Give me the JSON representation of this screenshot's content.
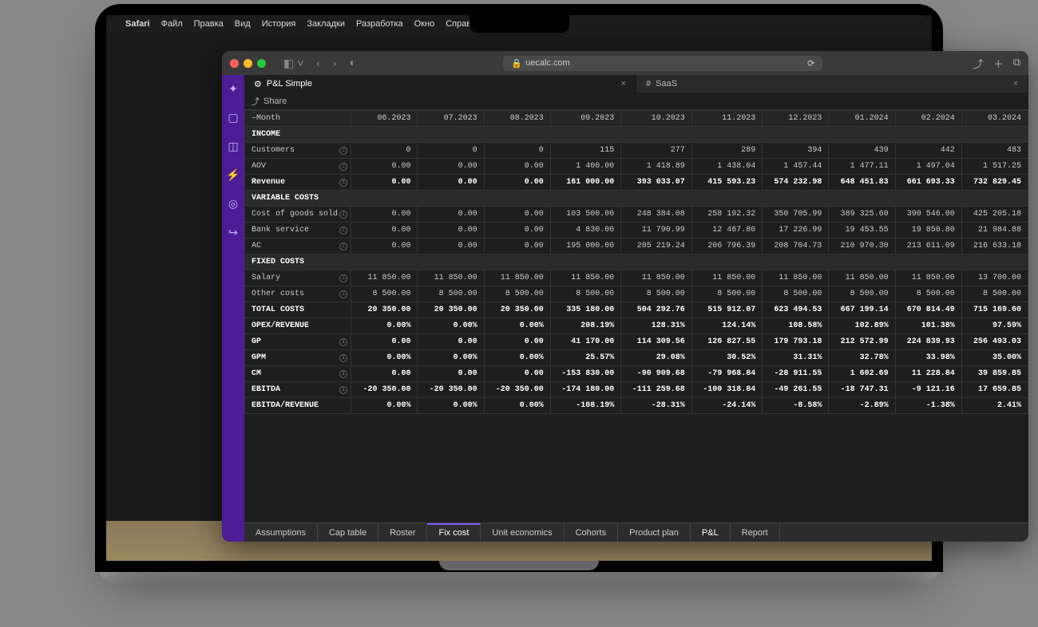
{
  "menubar": {
    "apple": "",
    "app_name": "Safari",
    "items": [
      "Файл",
      "Правка",
      "Вид",
      "История",
      "Закладки",
      "Разработка",
      "Окно",
      "Справка"
    ]
  },
  "browser": {
    "url": "uecalc.com",
    "lock": "🔒"
  },
  "tabs": [
    {
      "icon": "⚙",
      "label": "P&L Simple",
      "active": true
    },
    {
      "icon": "#",
      "label": "SaaS",
      "active": false
    }
  ],
  "share_label": "Share",
  "table": {
    "header_first": "Month",
    "months": [
      "06.2023",
      "07.2023",
      "08.2023",
      "09.2023",
      "10.2023",
      "11.2023",
      "12.2023",
      "01.2024",
      "02.2024",
      "03.2024"
    ],
    "rows": [
      {
        "type": "section",
        "label": "INCOME"
      },
      {
        "label": "Customers",
        "info": true,
        "values": [
          "0",
          "0",
          "0",
          "115",
          "277",
          "289",
          "394",
          "439",
          "442",
          "483"
        ]
      },
      {
        "label": "AOV",
        "info": true,
        "values": [
          "0.00",
          "0.00",
          "0.00",
          "1 400.00",
          "1 418.89",
          "1 438.04",
          "1 457.44",
          "1 477.11",
          "1 497.04",
          "1 517.25"
        ]
      },
      {
        "label": "Revenue",
        "info": true,
        "bold": true,
        "values": [
          "0.00",
          "0.00",
          "0.00",
          "161 000.00",
          "393 033.07",
          "415 593.23",
          "574 232.98",
          "648 451.83",
          "661 693.33",
          "732 829.45"
        ]
      },
      {
        "type": "section",
        "label": "VARIABLE COSTS"
      },
      {
        "label": "Cost of goods sold",
        "info": true,
        "values": [
          "0.00",
          "0.00",
          "0.00",
          "103 500.00",
          "248 384.08",
          "258 192.32",
          "350 705.99",
          "389 325.60",
          "390 546.00",
          "425 205.18"
        ]
      },
      {
        "label": "Bank service",
        "info": true,
        "values": [
          "0.00",
          "0.00",
          "0.00",
          "4 830.00",
          "11 790.99",
          "12 467.80",
          "17 226.99",
          "19 453.55",
          "19 850.80",
          "21 984.88"
        ]
      },
      {
        "label": "AC",
        "info": true,
        "values": [
          "0.00",
          "0.00",
          "0.00",
          "195 000.00",
          "205 219.24",
          "206 796.39",
          "208 704.73",
          "210 970.30",
          "213 611.09",
          "216 633.18"
        ]
      },
      {
        "type": "section",
        "label": "FIXED COSTS"
      },
      {
        "label": "Salary",
        "info": true,
        "values": [
          "11 850.00",
          "11 850.00",
          "11 850.00",
          "11 850.00",
          "11 850.00",
          "11 850.00",
          "11 850.00",
          "11 850.00",
          "11 850.00",
          "13 700.00"
        ]
      },
      {
        "label": "Other costs",
        "info": true,
        "values": [
          "8 500.00",
          "8 500.00",
          "8 500.00",
          "8 500.00",
          "8 500.00",
          "8 500.00",
          "8 500.00",
          "8 500.00",
          "8 500.00",
          "8 500.00"
        ]
      },
      {
        "label": "TOTAL COSTS",
        "bold": true,
        "values": [
          "20 350.00",
          "20 350.00",
          "20 350.00",
          "335 180.00",
          "504 292.76",
          "515 912.07",
          "623 494.53",
          "667 199.14",
          "670 814.49",
          "715 169.60"
        ]
      },
      {
        "label": "OPEX/REVENUE",
        "bold": true,
        "values": [
          "0.00%",
          "0.00%",
          "0.00%",
          "208.19%",
          "128.31%",
          "124.14%",
          "108.58%",
          "102.89%",
          "101.38%",
          "97.59%"
        ]
      },
      {
        "label": "GP",
        "info": true,
        "bold": true,
        "values": [
          "0.00",
          "0.00",
          "0.00",
          "41 170.00",
          "114 309.56",
          "126 827.55",
          "179 793.18",
          "212 572.99",
          "224 839.93",
          "256 493.03"
        ]
      },
      {
        "label": "GPM",
        "info": true,
        "bold": true,
        "values": [
          "0.00%",
          "0.00%",
          "0.00%",
          "25.57%",
          "29.08%",
          "30.52%",
          "31.31%",
          "32.78%",
          "33.98%",
          "35.00%"
        ]
      },
      {
        "label": "CM",
        "info": true,
        "bold": true,
        "values": [
          "0.00",
          "0.00",
          "0.00",
          "-153 830.00",
          "-90 909.68",
          "-79 968.84",
          "-28 911.55",
          "1 602.69",
          "11 228.84",
          "39 859.85"
        ]
      },
      {
        "label": "EBITDA",
        "info": true,
        "bold": true,
        "values": [
          "-20 350.00",
          "-20 350.00",
          "-20 350.00",
          "-174 180.00",
          "-111 259.68",
          "-100 318.84",
          "-49 261.55",
          "-18 747.31",
          "-9 121.16",
          "17 659.85"
        ]
      },
      {
        "label": "EBITDA/REVENUE",
        "bold": true,
        "values": [
          "0.00%",
          "0.00%",
          "0.00%",
          "-108.19%",
          "-28.31%",
          "-24.14%",
          "-8.58%",
          "-2.89%",
          "-1.38%",
          "2.41%"
        ]
      }
    ]
  },
  "bottom_tabs": [
    {
      "label": "Assumptions"
    },
    {
      "label": "Cap table"
    },
    {
      "label": "Roster"
    },
    {
      "label": "Fix cost",
      "active": true
    },
    {
      "label": "Unit economics"
    },
    {
      "label": "Cohorts"
    },
    {
      "label": "Product plan"
    },
    {
      "label": "P&L",
      "highlight": true
    },
    {
      "label": "Report"
    }
  ]
}
